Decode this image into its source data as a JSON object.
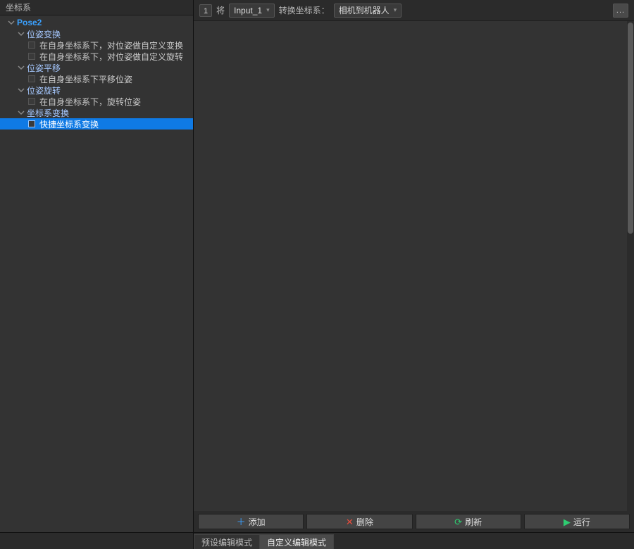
{
  "sidebar": {
    "title": "坐标系",
    "root": "Pose2",
    "groups": [
      {
        "name": "位姿变换",
        "items": [
          "在自身坐标系下，对位姿做自定义变换",
          "在自身坐标系下，对位姿做自定义旋转"
        ]
      },
      {
        "name": "位姿平移",
        "items": [
          "在自身坐标系下平移位姿"
        ]
      },
      {
        "name": "位姿旋转",
        "items": [
          "在自身坐标系下，旋转位姿"
        ]
      },
      {
        "name": "坐标系变换",
        "items": [
          "快捷坐标系变换"
        ]
      }
    ],
    "selected": "快捷坐标系变换"
  },
  "param_row": {
    "index": "1",
    "word_apply": "将",
    "input_dd": "Input_1",
    "label_convert": "转换坐标系：",
    "target_dd": "相机到机器人",
    "more": "..."
  },
  "buttons": {
    "add": "添加",
    "delete": "删除",
    "refresh": "刷新",
    "run": "运行"
  },
  "mode_bar": {
    "preset": "预设编辑模式",
    "custom": "自定义编辑模式"
  }
}
